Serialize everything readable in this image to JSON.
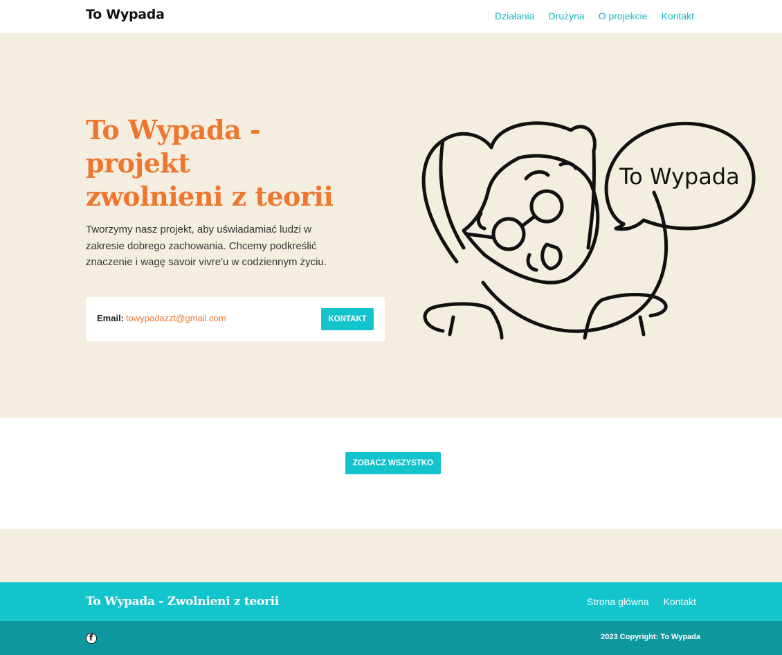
{
  "navbar": {
    "brand": "To Wypada",
    "links": [
      "Działania",
      "Drużyna",
      "O projekcie",
      "Kontakt"
    ]
  },
  "hero": {
    "title": "To Wypada - projekt zwolnieni z teorii",
    "text": "Tworzymy nasz projekt, aby uświadamiać ludzi w zakresie dobrego zachowania. Chcemy podkreślić znaczenie i wagę savoir vivre'u w codziennym życiu.",
    "email_label": "Email:",
    "email_value": "towypadazzt@gmail.com",
    "contact_button": "KONTAKT",
    "illustration_text": "To Wypada"
  },
  "middle": {
    "see_all_button": "ZOBACZ WSZYSTKO"
  },
  "footer": {
    "title": "To Wypada - Zwolnieni z teorii",
    "links": [
      "Strona główna",
      "Kontakt"
    ],
    "facebook_icon": "f",
    "copyright": "2023 Copyright: To Wypada"
  },
  "colors": {
    "accent_orange": "#f0762e",
    "accent_teal": "#14c4cd",
    "dark_teal": "#0e979e",
    "beige": "#f3eee0"
  },
  "icons": [
    "facebook-icon"
  ]
}
